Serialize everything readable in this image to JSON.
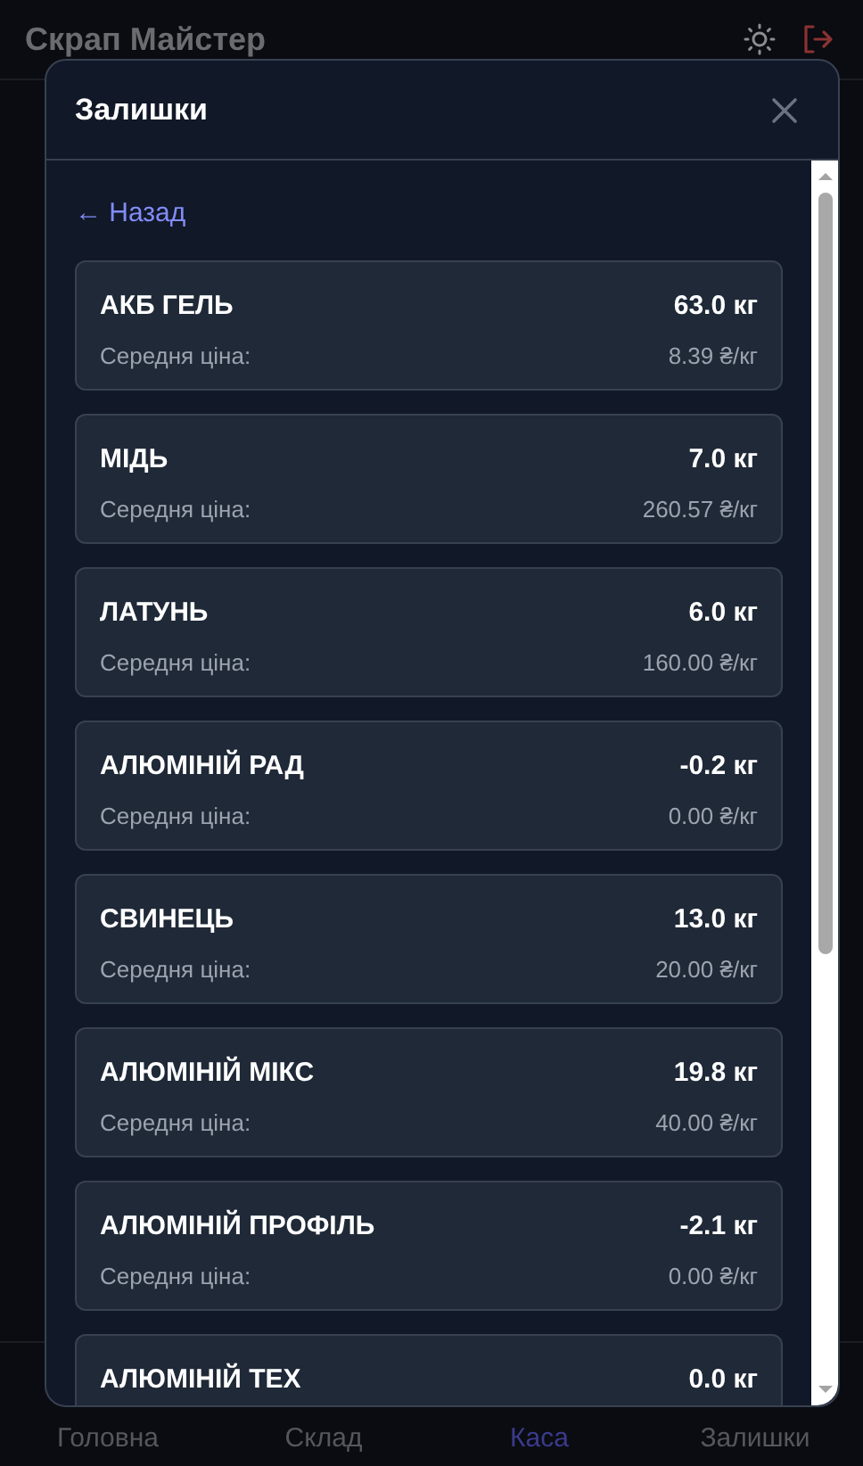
{
  "app": {
    "title": "Скрап Майстер"
  },
  "nav": [
    {
      "label": "Головна",
      "selected": false
    },
    {
      "label": "Склад",
      "selected": false
    },
    {
      "label": "Каса",
      "selected": true
    },
    {
      "label": "Залишки",
      "selected": false
    }
  ],
  "modal": {
    "title": "Залишки",
    "back": "← Назад",
    "items": [
      {
        "name": "АКБ ГЕЛЬ",
        "qty": "63.0 кг",
        "price_label": "Середня ціна:",
        "price": "8.39 ₴/кг"
      },
      {
        "name": "МІДЬ",
        "qty": "7.0 кг",
        "price_label": "Середня ціна:",
        "price": "260.57 ₴/кг"
      },
      {
        "name": "ЛАТУНЬ",
        "qty": "6.0 кг",
        "price_label": "Середня ціна:",
        "price": "160.00 ₴/кг"
      },
      {
        "name": "АЛЮМІНІЙ РАД",
        "qty": "-0.2 кг",
        "price_label": "Середня ціна:",
        "price": "0.00 ₴/кг"
      },
      {
        "name": "СВИНЕЦЬ",
        "qty": "13.0 кг",
        "price_label": "Середня ціна:",
        "price": "20.00 ₴/кг"
      },
      {
        "name": "АЛЮМІНІЙ МІКС",
        "qty": "19.8 кг",
        "price_label": "Середня ціна:",
        "price": "40.00 ₴/кг"
      },
      {
        "name": "АЛЮМІНІЙ ПРОФІЛЬ",
        "qty": "-2.1 кг",
        "price_label": "Середня ціна:",
        "price": "0.00 ₴/кг"
      },
      {
        "name": "АЛЮМІНІЙ ТЕХ",
        "qty": "0.0 кг"
      }
    ]
  }
}
